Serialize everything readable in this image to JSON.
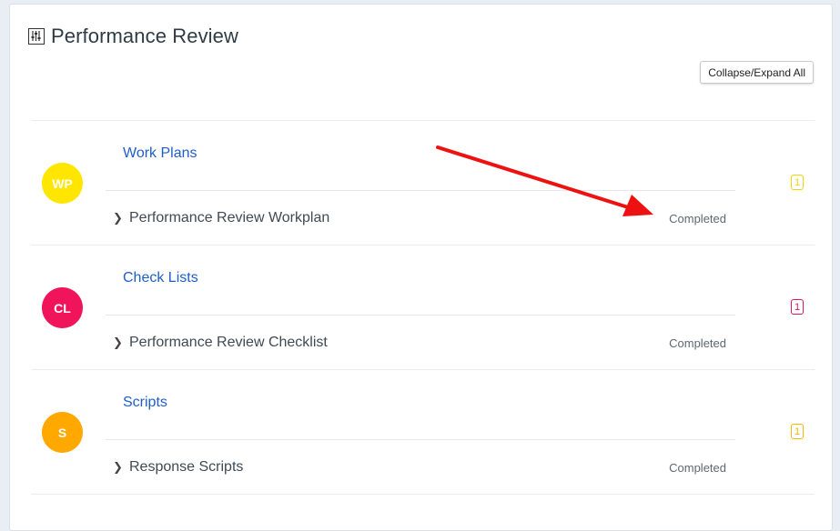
{
  "page": {
    "title": "Performance Review",
    "collapse_label": "Collapse/Expand All"
  },
  "sections": [
    {
      "initials": "WP",
      "title": "Work Plans",
      "color": "#ffe600",
      "item_label": "Performance Review Workplan",
      "item_status": "Completed",
      "count": "1",
      "badge_color": "#f5d400"
    },
    {
      "initials": "CL",
      "title": "Check Lists",
      "color": "#f0145a",
      "item_label": "Performance Review Checklist",
      "item_status": "Completed",
      "count": "1",
      "badge_color": "#e0145a"
    },
    {
      "initials": "S",
      "title": "Scripts",
      "color": "#ffa800",
      "item_label": "Response Scripts",
      "item_status": "Completed",
      "count": "1",
      "badge_color": "#f5b800"
    }
  ],
  "annotation": {
    "arrow_color": "#ee1111"
  }
}
